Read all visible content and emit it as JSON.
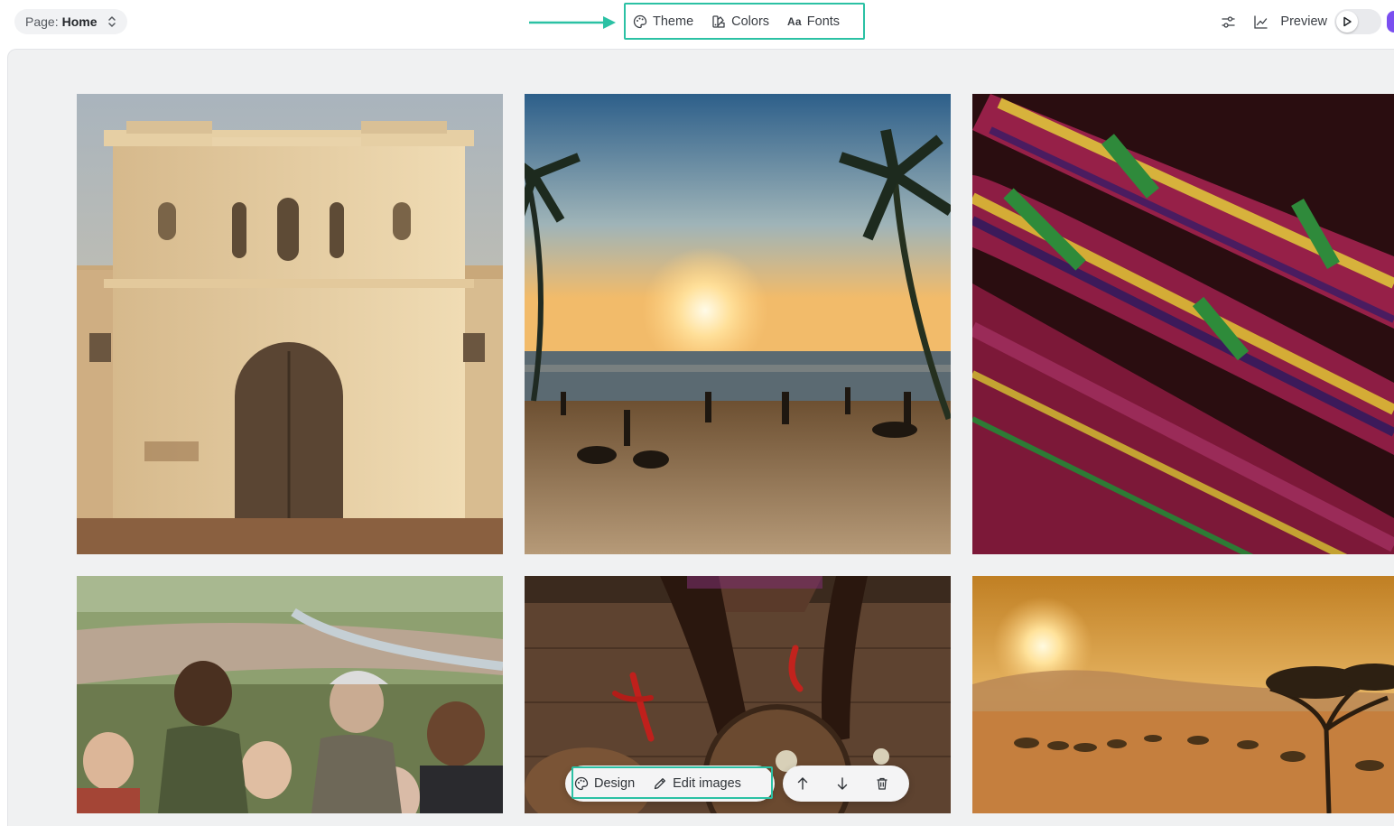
{
  "topbar": {
    "page_prefix": "Page:",
    "page_name": "Home",
    "tools": {
      "theme": "Theme",
      "colors": "Colors",
      "fonts_glyph": "Aa",
      "fonts": "Fonts"
    },
    "preview": "Preview",
    "icons": {
      "settings": "sliders-icon",
      "analytics": "line-chart-icon",
      "play": "play-icon"
    }
  },
  "gallery": {
    "images": [
      {
        "subject": "fort-gate-photo"
      },
      {
        "subject": "beach-sunset-photo"
      },
      {
        "subject": "kente-cloth-photo"
      },
      {
        "subject": "group-travelers-photo"
      },
      {
        "subject": "cooking-table-photo"
      },
      {
        "subject": "savanna-sunset-photo"
      }
    ]
  },
  "floating_toolbar": {
    "design": "Design",
    "edit_images": "Edit images",
    "icons": {
      "up": "arrow-up-icon",
      "down": "arrow-down-icon",
      "delete": "trash-icon"
    }
  },
  "colors": {
    "highlight": "#2bc1a4",
    "canvas_bg": "#f0f1f2",
    "avatar": "#7a4ff0"
  }
}
